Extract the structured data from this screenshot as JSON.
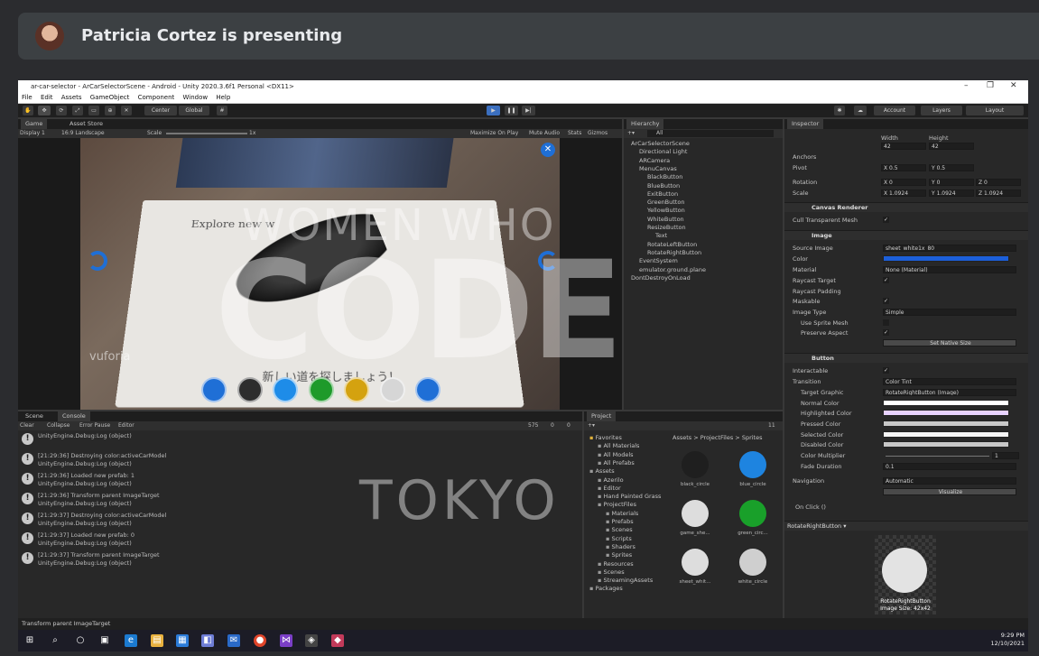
{
  "meet": {
    "presenter_text": "Patricia Cortez is presenting"
  },
  "window": {
    "title": "ar-car-selector - ArCarSelectorScene - Android - Unity 2020.3.6f1 Personal <DX11>",
    "controls": [
      "–",
      "❐",
      "✕"
    ]
  },
  "menu": [
    "File",
    "Edit",
    "Assets",
    "GameObject",
    "Component",
    "Window",
    "Help"
  ],
  "toolbar": {
    "center": "Center",
    "global": "Global",
    "account": "Account",
    "layers": "Layers",
    "layout": "Layout"
  },
  "game": {
    "tabs": [
      "Game",
      "Asset Store"
    ],
    "display": "Display 1",
    "aspect": "16:9 Landscape",
    "scale_label": "Scale",
    "scale_value": "1x",
    "options": [
      "Maximize On Play",
      "Mute Audio",
      "Stats",
      "Gizmos"
    ],
    "paper_text_1": "Explore new w",
    "paper_text_2": "新しい道を探しましょう！",
    "brand": "vuforia",
    "buttons": [
      {
        "name": "rotate-left",
        "color": "#1f6fd6"
      },
      {
        "name": "black",
        "color": "#2d2d2d"
      },
      {
        "name": "blue",
        "color": "#1e8ce8"
      },
      {
        "name": "green",
        "color": "#1e9a2a"
      },
      {
        "name": "yellow",
        "color": "#d4a20f"
      },
      {
        "name": "white",
        "color": "#d6d6d6"
      },
      {
        "name": "zoom",
        "color": "#1f6fd6"
      }
    ]
  },
  "hierarchy": {
    "tab": "Hierarchy",
    "search": "All",
    "items": [
      {
        "label": "ArCarSelectorScene",
        "level": 0
      },
      {
        "label": "Directional Light",
        "level": 1
      },
      {
        "label": "ARCamera",
        "level": 1
      },
      {
        "label": "MenuCanvas",
        "level": 1
      },
      {
        "label": "BlackButton",
        "level": 2
      },
      {
        "label": "BlueButton",
        "level": 2
      },
      {
        "label": "ExitButton",
        "level": 2
      },
      {
        "label": "GreenButton",
        "level": 2
      },
      {
        "label": "YellowButton",
        "level": 2
      },
      {
        "label": "WhiteButton",
        "level": 2
      },
      {
        "label": "ResizeButton",
        "level": 2
      },
      {
        "label": "Text",
        "level": 3
      },
      {
        "label": "RotateLeftButton",
        "level": 2
      },
      {
        "label": "RotateRightButton",
        "level": 2
      },
      {
        "label": "EventSystem",
        "level": 1
      },
      {
        "label": "emulator.ground.plane",
        "level": 1
      },
      {
        "label": "DontDestroyOnLoad",
        "level": 0
      }
    ]
  },
  "inspector": {
    "tab": "Inspector",
    "width_label": "Width",
    "height_label": "Height",
    "width": "42",
    "height": "42",
    "anchors": "Anchors",
    "pivot": "Pivot",
    "pivot_x": "X 0.5",
    "pivot_y": "Y 0.5",
    "rotation": "Rotation",
    "rot_x": "X 0",
    "rot_y": "Y 0",
    "rot_z": "Z 0",
    "scale": "Scale",
    "scale_x": "X 1.0924",
    "scale_y": "Y 1.0924",
    "scale_z": "Z 1.0924",
    "canvas_renderer": "Canvas Renderer",
    "cull_mesh": "Cull Transparent Mesh",
    "image": "Image",
    "source_image_label": "Source Image",
    "source_image": "sheet_white1x_80",
    "color_label": "Color",
    "image_color": "#1c5fd9",
    "material_label": "Material",
    "material": "None (Material)",
    "raycast_target": "Raycast Target",
    "raycast_padding": "Raycast Padding",
    "maskable": "Maskable",
    "image_type_label": "Image Type",
    "image_type": "Simple",
    "use_sprite_mesh": "Use Sprite Mesh",
    "preserve_aspect": "Preserve Aspect",
    "set_native_size": "Set Native Size",
    "button": "Button",
    "interactable": "Interactable",
    "transition_label": "Transition",
    "transition": "Color Tint",
    "target_graphic_label": "Target Graphic",
    "target_graphic": "RotateRightButton (Image)",
    "normal_color": "Normal Color",
    "highlighted_color": "Highlighted Color",
    "pressed_color": "Pressed Color",
    "selected_color": "Selected Color",
    "disabled_color": "Disabled Color",
    "color_multiplier": "Color Multiplier",
    "color_multiplier_value": "1",
    "fade_duration": "Fade Duration",
    "fade_value": "0.1",
    "navigation_label": "Navigation",
    "navigation": "Automatic",
    "visualize": "Visualize",
    "on_click": "On Click ()",
    "preview_title": "RotateRightButton",
    "preview_caption_1": "RotateRightButton",
    "preview_caption_2": "Image Size: 42x42"
  },
  "console": {
    "tabs": [
      "Scene",
      "Console"
    ],
    "buttons": [
      "Clear",
      "Collapse",
      "Error Pause",
      "Editor"
    ],
    "count_log": "575",
    "count_warn": "0",
    "count_err": "0",
    "entries": [
      {
        "line1": "",
        "line2": "UnityEngine.Debug:Log (object)"
      },
      {
        "line1": "[21:29:36] Destroying color:activeCarModel",
        "line2": "UnityEngine.Debug:Log (object)"
      },
      {
        "line1": "[21:29:36] Loaded new prefab: 1",
        "line2": "UnityEngine.Debug:Log (object)"
      },
      {
        "line1": "[21:29:36] Transform parent ImageTarget",
        "line2": "UnityEngine.Debug:Log (object)"
      },
      {
        "line1": "[21:29:37] Destroying color:activeCarModel",
        "line2": "UnityEngine.Debug:Log (object)"
      },
      {
        "line1": "[21:29:37] Loaded new prefab: 0",
        "line2": "UnityEngine.Debug:Log (object)"
      },
      {
        "line1": "[21:29:37] Transform parent ImageTarget",
        "line2": "UnityEngine.Debug:Log (object)"
      }
    ]
  },
  "project": {
    "tab": "Project",
    "count": "11",
    "breadcrumb": "Assets > ProjectFiles > Sprites",
    "tree": [
      {
        "label": "Favorites",
        "level": 0
      },
      {
        "label": "All Materials",
        "level": 1
      },
      {
        "label": "All Models",
        "level": 1
      },
      {
        "label": "All Prefabs",
        "level": 1
      },
      {
        "label": "Assets",
        "level": 0
      },
      {
        "label": "Azerilo",
        "level": 1
      },
      {
        "label": "Editor",
        "level": 1
      },
      {
        "label": "Hand Painted Grass",
        "level": 1
      },
      {
        "label": "ProjectFiles",
        "level": 1
      },
      {
        "label": "Materials",
        "level": 2
      },
      {
        "label": "Prefabs",
        "level": 2
      },
      {
        "label": "Scenes",
        "level": 2
      },
      {
        "label": "Scripts",
        "level": 2
      },
      {
        "label": "Shaders",
        "level": 2
      },
      {
        "label": "Sprites",
        "level": 2
      },
      {
        "label": "Resources",
        "level": 1
      },
      {
        "label": "Scenes",
        "level": 1
      },
      {
        "label": "StreamingAssets",
        "level": 1
      },
      {
        "label": "Packages",
        "level": 0
      }
    ],
    "assets": [
      {
        "label": "black_circle",
        "color": "#1f1f1f"
      },
      {
        "label": "blue_circle",
        "color": "#1e84e0"
      },
      {
        "label": "game_she...",
        "color": "#dddddd"
      },
      {
        "label": "green_circ...",
        "color": "#19a02a"
      },
      {
        "label": "sheet_whit...",
        "color": "#dddddd"
      },
      {
        "label": "white_circle",
        "color": "#cfcfcf"
      }
    ]
  },
  "status": "Transform parent ImageTarget",
  "taskbar": {
    "time": "9:29 PM",
    "date": "12/10/2021"
  },
  "watermark": {
    "line1": "WOMEN WHO",
    "line2": "CODE",
    "line3": "TOKYO"
  }
}
